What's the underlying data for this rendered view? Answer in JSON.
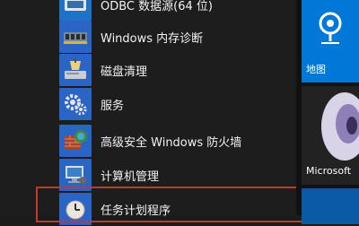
{
  "menu": {
    "items": [
      {
        "label": "ODBC 数据源(64 位)",
        "icon": "odbc-icon"
      },
      {
        "label": "Windows 内存诊断",
        "icon": "memory-diagnostic-icon"
      },
      {
        "label": "磁盘清理",
        "icon": "disk-cleanup-icon"
      },
      {
        "label": "服务",
        "icon": "services-gear-icon"
      },
      {
        "label": "高级安全 Windows 防火墙",
        "icon": "firewall-icon"
      },
      {
        "label": "计算机管理",
        "icon": "computer-management-icon"
      },
      {
        "label": "任务计划程序",
        "icon": "task-scheduler-clock-icon"
      }
    ],
    "highlight_color": "#c0392b"
  },
  "tiles": {
    "maps": {
      "label": "地图",
      "color": "#0078d7",
      "icon": "map-pin-icon"
    },
    "edge": {
      "label": "Microsoft",
      "color": "#1a1a1a"
    }
  }
}
